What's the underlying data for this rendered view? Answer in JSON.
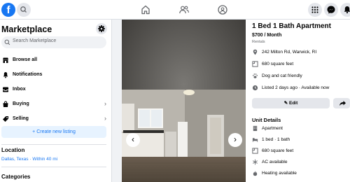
{
  "topbar": {
    "logo_letter": "f"
  },
  "sidebar": {
    "title": "Marketplace",
    "search_placeholder": "Search Marketplace",
    "items": [
      {
        "label": "Browse all"
      },
      {
        "label": "Notifications"
      },
      {
        "label": "Inbox"
      },
      {
        "label": "Buying"
      },
      {
        "label": "Selling"
      }
    ],
    "create_label": "Create new listing",
    "location_title": "Location",
    "location_value": "Dallas, Texas · Within 40 mi",
    "categories_title": "Categories"
  },
  "listing": {
    "title": "1 Bed 1 Bath Apartment",
    "price": "$700 / Month",
    "category": "Rentals",
    "facts": [
      {
        "icon": "location-pin-icon",
        "text": "242 Milton Rd, Warwick, RI"
      },
      {
        "icon": "ruler-icon",
        "text": "680 square feet"
      },
      {
        "icon": "paw-icon",
        "text": "Dog and cat friendly"
      },
      {
        "icon": "clock-icon",
        "text": "Listed 2 days ago · Available now"
      }
    ],
    "edit_label": "Edit",
    "unit_details_title": "Unit Details",
    "unit_details": [
      {
        "icon": "building-icon",
        "text": "Apartment"
      },
      {
        "icon": "bed-icon",
        "text": "1 bed · 1 bath"
      },
      {
        "icon": "area-icon",
        "text": "680 square feet"
      },
      {
        "icon": "snowflake-icon",
        "text": "AC available"
      },
      {
        "icon": "flame-icon",
        "text": "Heating available"
      }
    ]
  },
  "colors": {
    "brand": "#1877f2",
    "page_bg": "#f0f2f5"
  }
}
